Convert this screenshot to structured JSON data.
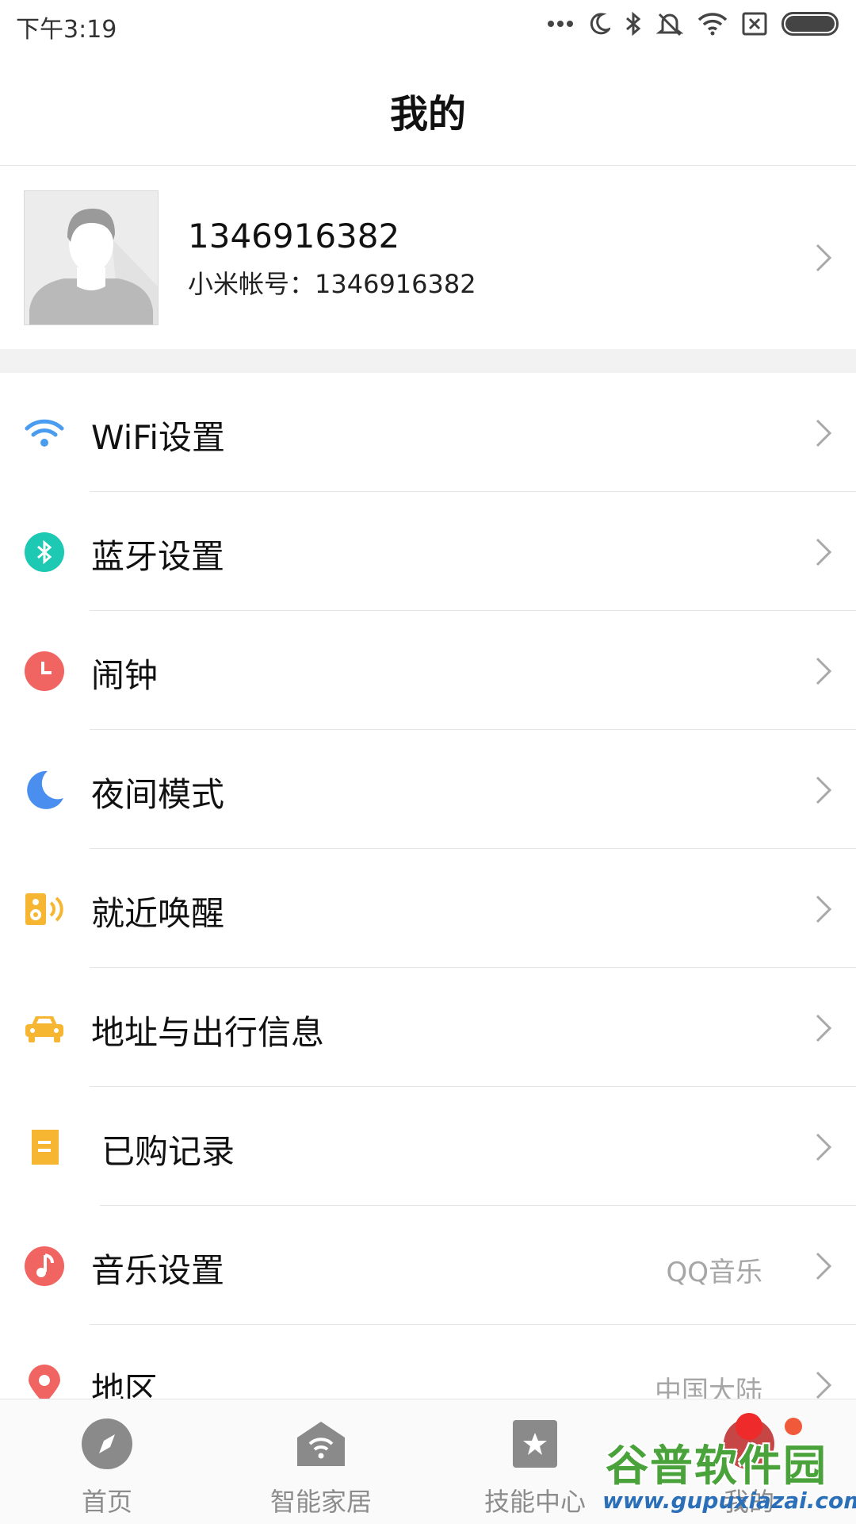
{
  "status_bar": {
    "time": "下午3:19",
    "icons": [
      "more-icon",
      "moon-icon",
      "bluetooth-icon",
      "mute-icon",
      "wifi-icon",
      "no-sim-icon",
      "battery-icon"
    ]
  },
  "header": {
    "title": "我的"
  },
  "profile": {
    "name": "1346916382",
    "account": "小米帐号：1346916382"
  },
  "settings": [
    {
      "label": "WiFi设置",
      "value": "",
      "icon": "wifi-icon",
      "color": "#4a9cf0"
    },
    {
      "label": "蓝牙设置",
      "value": "",
      "icon": "bluetooth-icon",
      "color": "#1ec9b3"
    },
    {
      "label": "闹钟",
      "value": "",
      "icon": "alarm-icon",
      "color": "#f06462"
    },
    {
      "label": "夜间模式",
      "value": "",
      "icon": "moon-icon",
      "color": "#4a8ff0"
    },
    {
      "label": "就近唤醒",
      "value": "",
      "icon": "speaker-icon",
      "color": "#f7b632"
    },
    {
      "label": "地址与出行信息",
      "value": "",
      "icon": "car-icon",
      "color": "#f7b632"
    },
    {
      "label": "已购记录",
      "value": "",
      "icon": "receipt-icon",
      "color": "#f7b632"
    },
    {
      "label": "音乐设置",
      "value": "QQ音乐",
      "icon": "music-icon",
      "color": "#f06462"
    },
    {
      "label": "地区",
      "value": "中国大陆",
      "icon": "location-icon",
      "color": "#f06462"
    }
  ],
  "bottom_nav": [
    {
      "label": "首页",
      "icon": "compass-icon"
    },
    {
      "label": "智能家居",
      "icon": "smart-home-icon"
    },
    {
      "label": "技能中心",
      "icon": "skill-star-icon"
    },
    {
      "label": "我的",
      "icon": "profile-icon"
    }
  ],
  "watermark": {
    "title": "谷普软件园",
    "url": "www.gupuxiazai.com"
  },
  "colors": {
    "badge_red": "#ee2a2a",
    "badge_orange": "#f05a3a",
    "nav_icon_gray": "#8a8a8a"
  }
}
